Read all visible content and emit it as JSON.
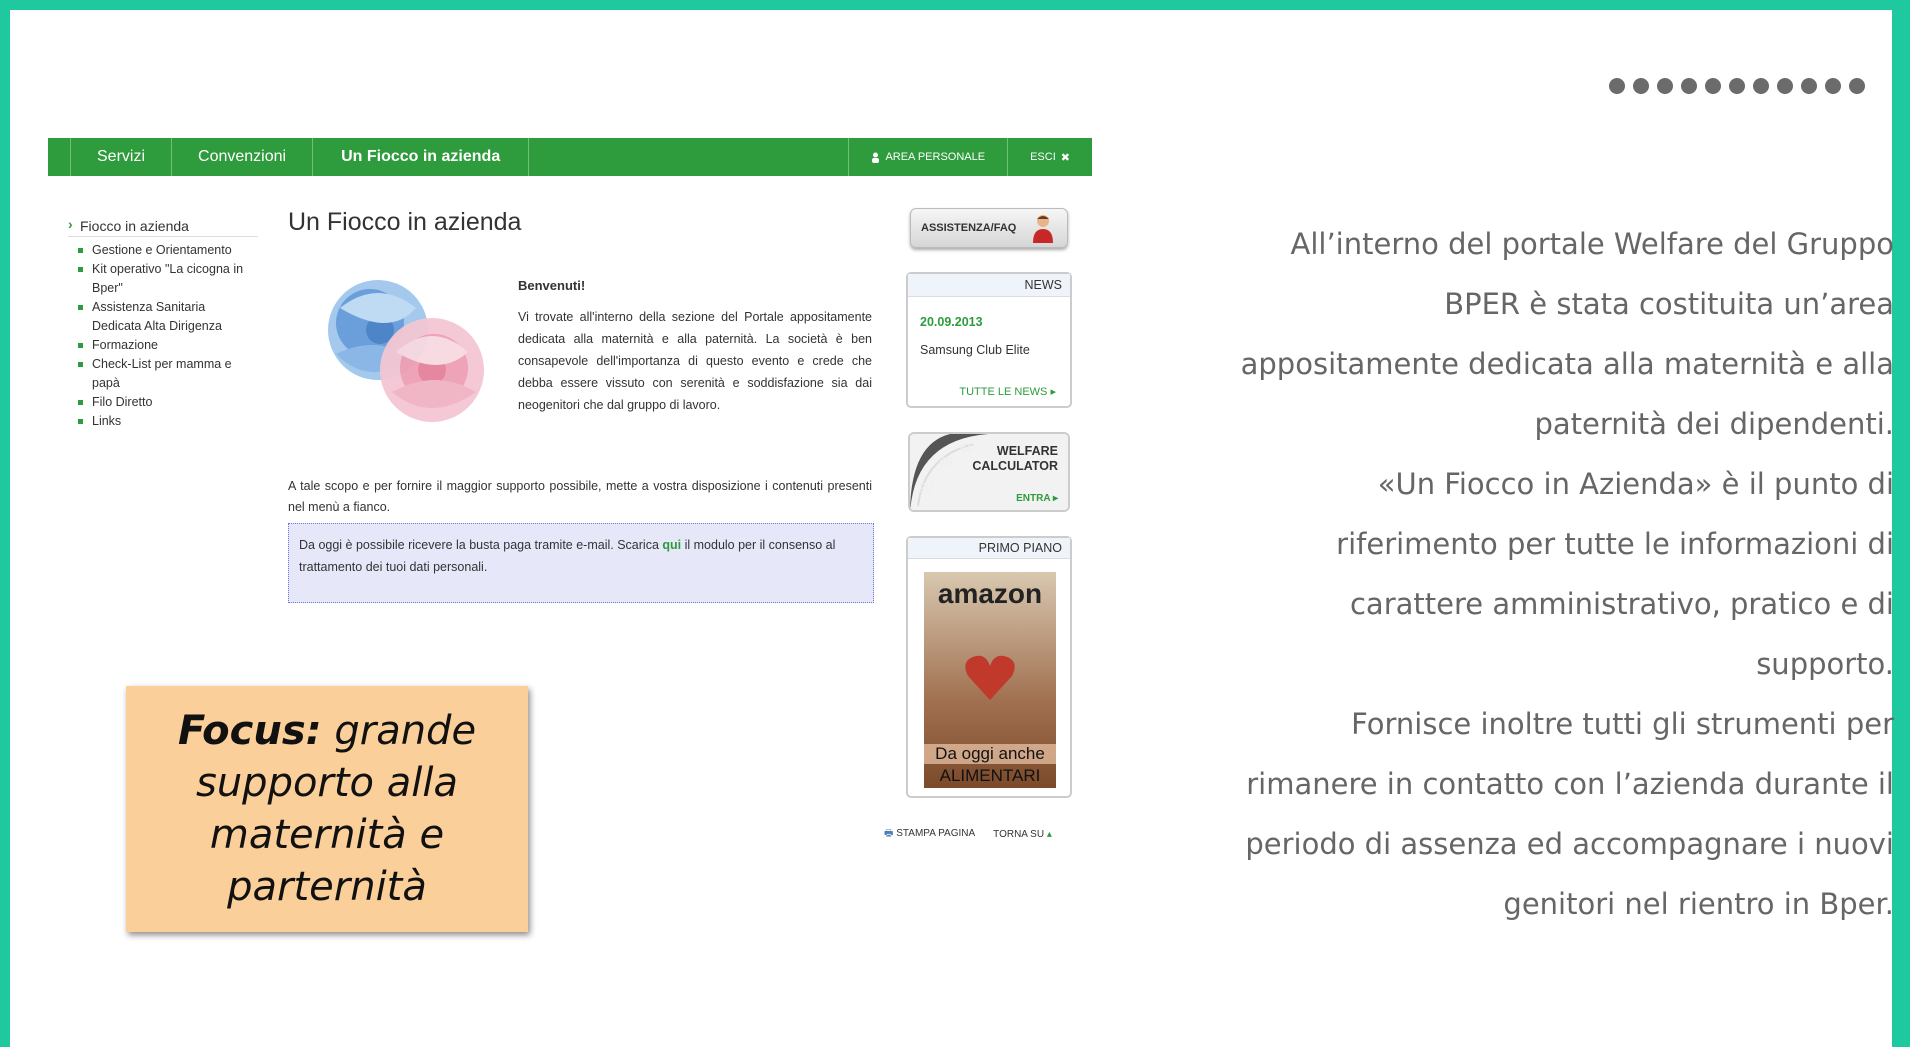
{
  "nav": {
    "items": [
      "Servizi",
      "Convenzioni",
      "Un Fiocco in azienda"
    ],
    "area_personale": "AREA PERSONALE",
    "esci": "ESCI"
  },
  "sidebar": {
    "heading": "Fiocco in azienda",
    "items": [
      "Gestione e Orientamento",
      "Kit operativo \"La cicogna in Bper\"",
      "Assistenza Sanitaria Dedicata Alta Dirigenza",
      "Formazione",
      "Check-List per mamma e papà",
      "Filo Diretto",
      "Links"
    ]
  },
  "content": {
    "title": "Un Fiocco in azienda",
    "welcome_title": "Benvenuti!",
    "welcome_text": "Vi trovate all'interno della sezione del Portale appositamente dedicata alla maternità e alla paternità. La società è ben consapevole dell'importanza di questo evento e crede che debba essere vissuto con serenità e soddisfazione sia dai neogenitori che dal gruppo di lavoro.",
    "scope_text": "A tale scopo e per fornire il maggior supporto possibile, mette a vostra disposizione i contenuti presenti nel menù a fianco.",
    "notice_before": "Da oggi è possibile ricevere la busta paga tramite e-mail. Scarica ",
    "notice_link": "qui",
    "notice_after": " il modulo per il consenso al trattamento dei tuoi dati personali."
  },
  "right": {
    "faq_label": "ASSISTENZA/FAQ",
    "news_title": "NEWS",
    "news_date": "20.09.2013",
    "news_item": "Samsung Club Elite",
    "news_all": "TUTTE LE NEWS",
    "calc_title_1": "WELFARE",
    "calc_title_2": "CALCULATOR",
    "calc_enter": "ENTRA",
    "primo_title": "PRIMO PIANO",
    "ad_brand": "amazon",
    "ad_line_1": "Da oggi anche",
    "ad_line_2": "ALIMENTARI"
  },
  "footer": {
    "print": "STAMPA PAGINA",
    "top": "TORNA SU"
  },
  "focus": {
    "bold": "Focus:",
    "line1": " grande",
    "line2": "supporto alla",
    "line3": "maternità e",
    "line4": "parternità"
  },
  "description": {
    "p1": "All’interno del portale Welfare del Gruppo BPER è stata costituita un’area appositamente dedicata alla maternità e alla paternità dei dipendenti.",
    "p2": "«Un Fiocco in Azienda» è il punto di riferimento per tutte le informazioni di carattere amministrativo, pratico e di supporto.",
    "p3": "Fornisce inoltre tutti gli strumenti per rimanere in contatto con l’azienda durante il periodo di assenza ed accompagnare i nuovi genitori nel rientro in Bper."
  },
  "colors": {
    "frame": "#1fc9a0",
    "nav": "#2e9b3c",
    "focus_box": "#fbcf99"
  }
}
